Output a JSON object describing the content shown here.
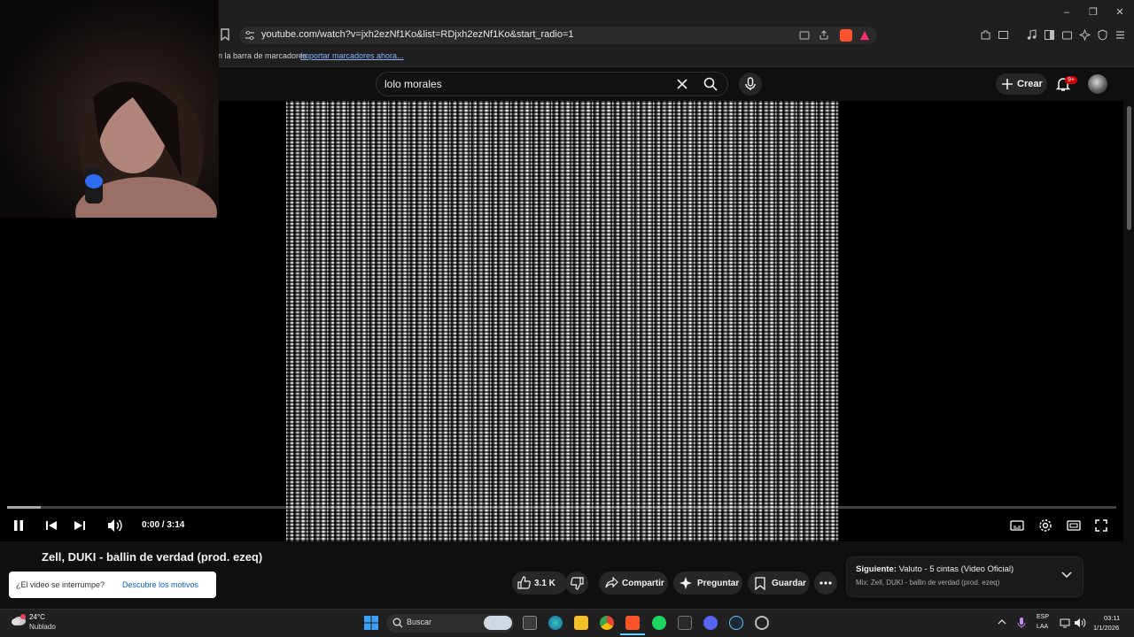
{
  "browser": {
    "url": "youtube.com/watch?v=jxh2ezNf1Ko&list=RDjxh2ezNf1Ko&start_radio=1",
    "bookmarks_bar_text": "n la barra de marcadores.",
    "bookmarks_import_link": "Importar marcadores ahora..."
  },
  "youtube": {
    "search_query": "lolo morales",
    "create_label": "Crear",
    "notification_badge": "9+",
    "player": {
      "time": "0:00 / 3:14",
      "progress_fraction": 0.0
    },
    "video_title": "Zell, DUKI - ballin de verdad (prod. ezeq)",
    "interrupt_question": "¿El video se interrumpe?",
    "interrupt_link": "Descubre los motivos",
    "actions": {
      "likes": "3.1 K",
      "share": "Compartir",
      "ask": "Preguntar",
      "save": "Guardar"
    },
    "up_next": {
      "prefix": "Siguiente:",
      "title": "Valuto - 5 cintas (Video Oficial)",
      "mix": "Mix: Zell, DUKI - ballin de verdad (prod. ezeq)"
    }
  },
  "taskbar": {
    "weather_temp": "24°C",
    "weather_desc": "Nublado",
    "search_label": "Buscar",
    "lang_line1": "ESP",
    "lang_line2": "LAA",
    "clock_time": "03:11",
    "clock_date": "1/1/2026"
  },
  "colors": {
    "bg": "#0f0f0f",
    "accent_red": "#cc0000",
    "link_blue": "#065fd4"
  }
}
